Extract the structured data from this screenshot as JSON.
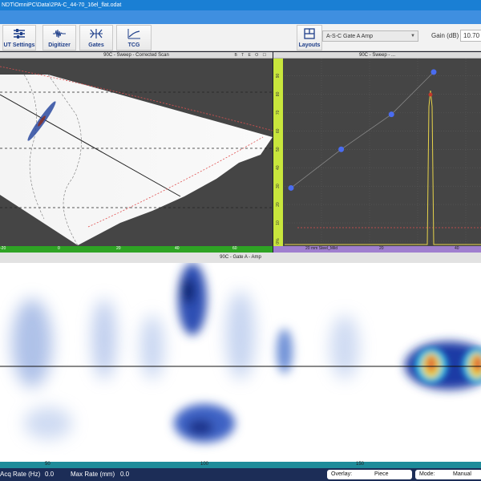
{
  "window": {
    "title": "NDT\\OmniPC\\Data\\2PA-C_44-70_16el_flat.odat"
  },
  "toolbar": {
    "ut_settings": "UT Settings",
    "digitizer": "Digitizer",
    "gates": "Gates",
    "tcg": "TCG",
    "layouts": "Layouts",
    "view_select": "A-S-C Gate A Amp",
    "gain_label": "Gain (dB)",
    "gain_value": "10.70"
  },
  "panels": {
    "sscan_title": "90C - Sweep - Corrected Scan",
    "sscan_icons": "B T E O ☐",
    "ascan_title": "90C - Sweep - ...",
    "cscan_title": "90C - Gate A - Amp"
  },
  "sscan_ruler": [
    "-20",
    "0",
    "20",
    "40",
    "60"
  ],
  "ascan_ruler": {
    "label": "20 mm Steel_Mild",
    "ticks": [
      "20",
      "40"
    ]
  },
  "ascan_yticks": [
    "0%",
    "10",
    "20",
    "30",
    "40",
    "50",
    "60",
    "70",
    "80",
    "90"
  ],
  "cscan_ruler": [
    "50",
    "100",
    "150"
  ],
  "status": {
    "acq_label": "Acq Rate (Hz)",
    "acq_value": "0.0",
    "max_label": "Max Rate (mm)",
    "max_value": "0.0",
    "overlay_label": "Overlay:",
    "overlay_value": "Piece",
    "mode_label": "Mode:",
    "mode_value": "Manual"
  },
  "chart_data": {
    "type": "line",
    "series": [
      {
        "name": "",
        "x": [
          0,
          19,
          38,
          54
        ],
        "values": [
          29,
          50,
          69,
          92
        ]
      }
    ],
    "ylim": [
      0,
      95
    ],
    "grid": true
  },
  "colors": {
    "titlebar": "#1a7fd4",
    "toolbar_text": "#1f3f8a",
    "green_ruler": "#2ea324",
    "purple_ruler": "#a07fcf",
    "status_bg": "#1c2d57",
    "tcg_points": "#4a6cf0"
  }
}
